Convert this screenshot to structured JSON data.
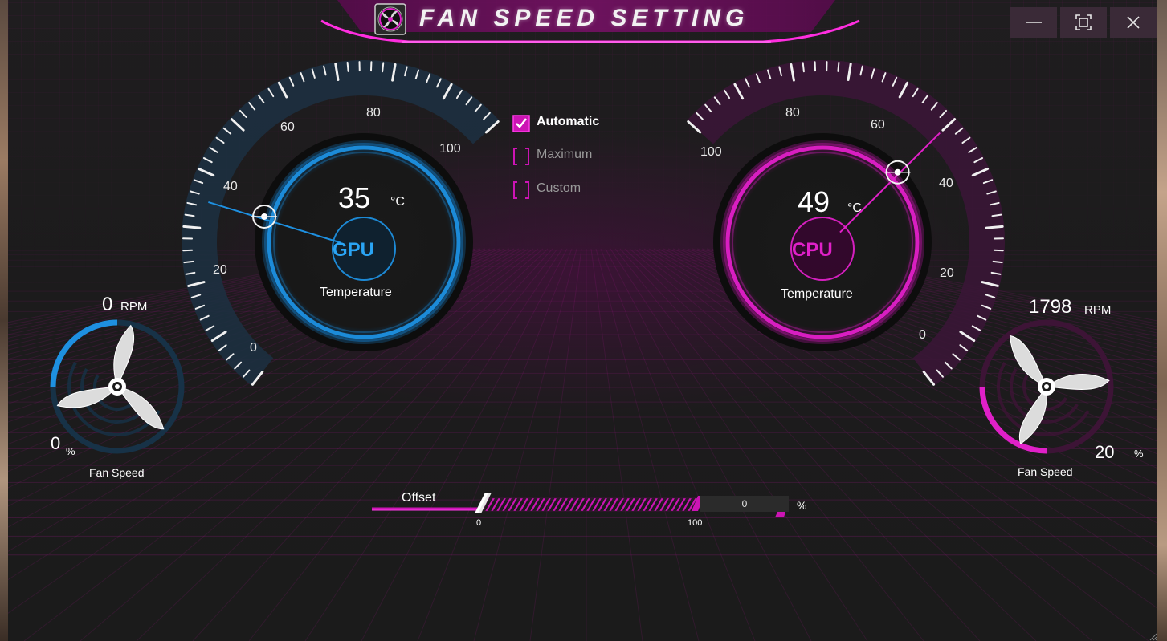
{
  "window": {
    "title": "FAN SPEED SETTING",
    "icon": "fan-app-icon",
    "buttons": {
      "minimize": "minimize-icon",
      "maximize": "maximize-icon",
      "close": "close-icon"
    }
  },
  "colors": {
    "gpu_accent": "#1e90e0",
    "cpu_accent": "#e020c8",
    "background": "#1b1b1b",
    "magenta_ui": "#cc14b4"
  },
  "gpu_gauge": {
    "ticks": [
      "0",
      "20",
      "40",
      "60",
      "80",
      "100"
    ],
    "temperature": "35",
    "unit": "°C",
    "chip": "GPU",
    "label": "Temperature",
    "needle_value": 35
  },
  "cpu_gauge": {
    "ticks": [
      "0",
      "20",
      "40",
      "60",
      "80",
      "100"
    ],
    "temperature": "49",
    "unit": "°C",
    "chip": "CPU",
    "label": "Temperature",
    "needle_value": 50
  },
  "gpu_fan": {
    "rpm": "0",
    "rpm_unit": "RPM",
    "percent": "0",
    "percent_unit": "%",
    "label": "Fan Speed",
    "level": 0.25
  },
  "cpu_fan": {
    "rpm": "1798",
    "rpm_unit": "RPM",
    "percent": "20",
    "percent_unit": "%",
    "label": "Fan Speed",
    "level": 0.25
  },
  "modes": [
    {
      "label": "Automatic",
      "checked": true
    },
    {
      "label": "Maximum",
      "checked": false
    },
    {
      "label": "Custom",
      "checked": false
    }
  ],
  "offset": {
    "label": "Offset",
    "min_label": "0",
    "max_label": "100",
    "value": "0",
    "unit": "%"
  }
}
